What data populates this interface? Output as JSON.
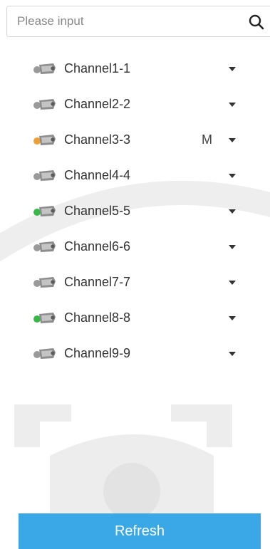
{
  "search": {
    "placeholder": "Please input",
    "value": ""
  },
  "channels": [
    {
      "label": "Channel1-1",
      "tag": "",
      "status": "gray",
      "status_color": "#9a9a9a"
    },
    {
      "label": "Channel2-2",
      "tag": "",
      "status": "gray",
      "status_color": "#9a9a9a"
    },
    {
      "label": "Channel3-3",
      "tag": "M",
      "status": "orange",
      "status_color": "#f0a030"
    },
    {
      "label": "Channel4-4",
      "tag": "",
      "status": "gray",
      "status_color": "#9a9a9a"
    },
    {
      "label": "Channel5-5",
      "tag": "",
      "status": "green",
      "status_color": "#33bb44"
    },
    {
      "label": "Channel6-6",
      "tag": "",
      "status": "gray",
      "status_color": "#9a9a9a"
    },
    {
      "label": "Channel7-7",
      "tag": "",
      "status": "gray",
      "status_color": "#9a9a9a"
    },
    {
      "label": "Channel8-8",
      "tag": "",
      "status": "green",
      "status_color": "#33bb44"
    },
    {
      "label": "Channel9-9",
      "tag": "",
      "status": "gray",
      "status_color": "#9a9a9a"
    }
  ],
  "refresh_button": {
    "label": "Refresh",
    "color": "#3aa8e6"
  },
  "icons": {
    "search": "search-icon",
    "camera": "camera-icon",
    "expand": "chevron-down-icon"
  }
}
